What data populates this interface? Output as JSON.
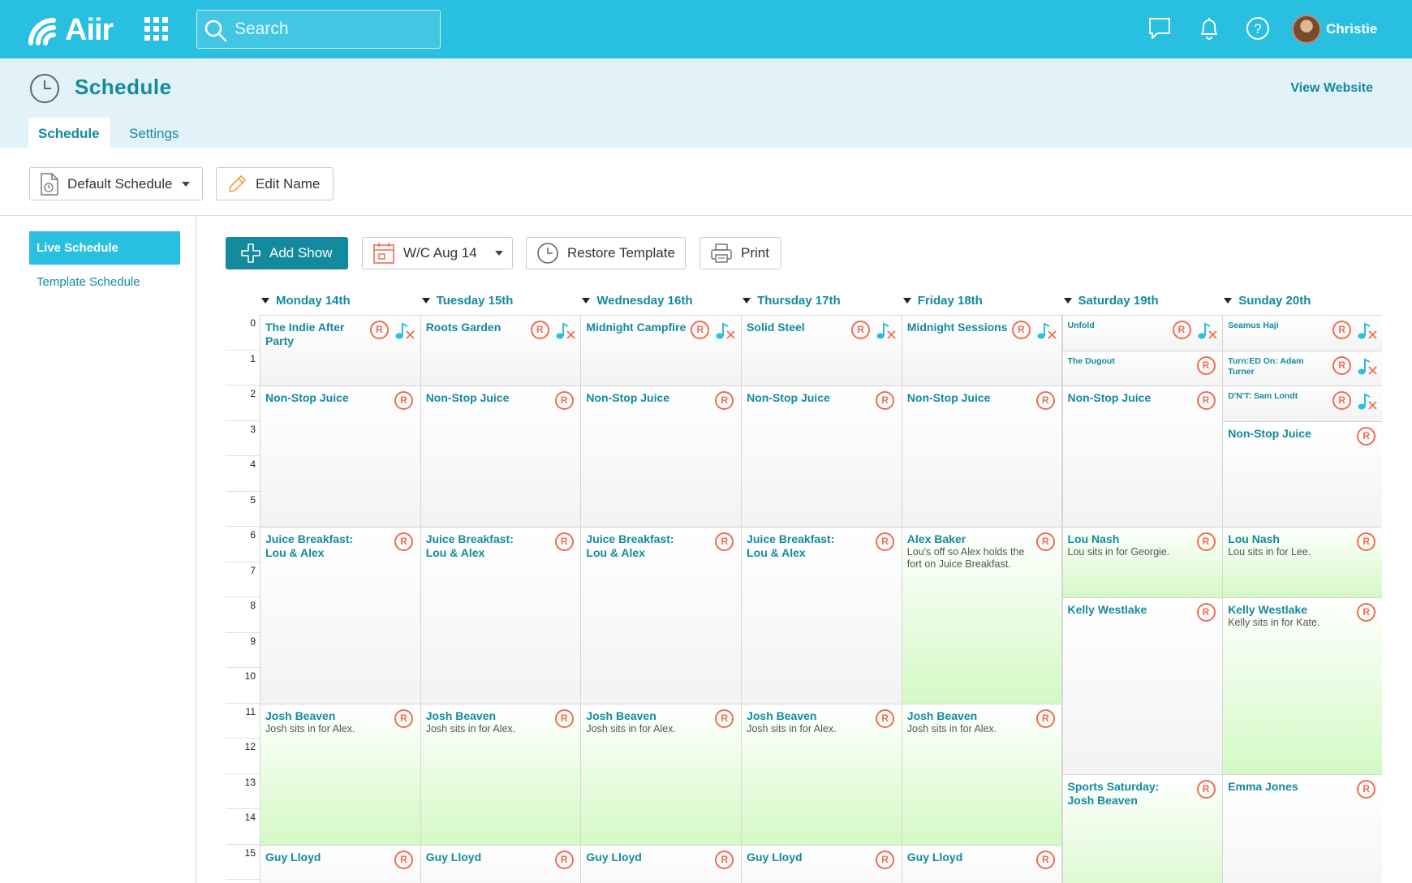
{
  "app": {
    "name": "Aiir",
    "user": "Christie"
  },
  "search": {
    "placeholder": "Search"
  },
  "page": {
    "title": "Schedule",
    "view_website": "View Website"
  },
  "tabs": [
    {
      "label": "Schedule",
      "active": true
    },
    {
      "label": "Settings",
      "active": false
    }
  ],
  "schedule_select": {
    "value": "Default Schedule"
  },
  "edit_name": "Edit Name",
  "sidebar": {
    "items": [
      {
        "label": "Live Schedule",
        "active": true
      },
      {
        "label": "Template Schedule",
        "active": false
      }
    ]
  },
  "toolbar": {
    "add_show": "Add Show",
    "week": "W/C Aug 14",
    "restore": "Restore Template",
    "print": "Print"
  },
  "colors": {
    "brand": "#29bfe1",
    "dark": "#138a9e",
    "subheader": "#e1f2f9",
    "remove_icon": "#ef6d52"
  },
  "hours": [
    "0",
    "1",
    "2",
    "3",
    "4",
    "5",
    "6",
    "7",
    "8",
    "9",
    "10",
    "11",
    "12",
    "13",
    "14",
    "15"
  ],
  "days": [
    "Monday 14th",
    "Tuesday 15th",
    "Wednesday 16th",
    "Thursday 17th",
    "Friday 18th",
    "Saturday 19th",
    "Sunday 20th"
  ],
  "shows": [
    {
      "day": 0,
      "start": 0,
      "end": 2,
      "title": "The Indie After Party",
      "note": "",
      "green": false,
      "music": true
    },
    {
      "day": 0,
      "start": 2,
      "end": 6,
      "title": "Non-Stop Juice",
      "note": "",
      "green": false,
      "music": false
    },
    {
      "day": 0,
      "start": 6,
      "end": 11,
      "title": "Juice Breakfast: Lou & Alex",
      "note": "",
      "green": false,
      "music": false,
      "remove": true
    },
    {
      "day": 0,
      "start": 11,
      "end": 15,
      "title": "Josh Beaven",
      "note": "Josh sits in for Alex.",
      "green": true,
      "music": false,
      "remove": true
    },
    {
      "day": 0,
      "start": 15,
      "end": 17,
      "title": "Guy Lloyd",
      "note": "",
      "green": false,
      "music": false,
      "remove": true
    },
    {
      "day": 1,
      "start": 0,
      "end": 2,
      "title": "Roots Garden",
      "note": "",
      "green": false,
      "music": true
    },
    {
      "day": 1,
      "start": 2,
      "end": 6,
      "title": "Non-Stop Juice",
      "note": "",
      "green": false,
      "music": false
    },
    {
      "day": 1,
      "start": 6,
      "end": 11,
      "title": "Juice Breakfast: Lou & Alex",
      "note": "",
      "green": false,
      "music": false,
      "remove": true
    },
    {
      "day": 1,
      "start": 11,
      "end": 15,
      "title": "Josh Beaven",
      "note": "Josh sits in for Alex.",
      "green": true,
      "music": false,
      "remove": true
    },
    {
      "day": 1,
      "start": 15,
      "end": 17,
      "title": "Guy Lloyd",
      "note": "",
      "green": false,
      "music": false,
      "remove": true
    },
    {
      "day": 2,
      "start": 0,
      "end": 2,
      "title": "Midnight Campfire",
      "note": "",
      "green": false,
      "music": true
    },
    {
      "day": 2,
      "start": 2,
      "end": 6,
      "title": "Non-Stop Juice",
      "note": "",
      "green": false,
      "music": false
    },
    {
      "day": 2,
      "start": 6,
      "end": 11,
      "title": "Juice Breakfast: Lou & Alex",
      "note": "",
      "green": false,
      "music": false,
      "remove": true
    },
    {
      "day": 2,
      "start": 11,
      "end": 15,
      "title": "Josh Beaven",
      "note": "Josh sits in for Alex.",
      "green": true,
      "music": false,
      "remove": true
    },
    {
      "day": 2,
      "start": 15,
      "end": 17,
      "title": "Guy Lloyd",
      "note": "",
      "green": false,
      "music": false,
      "remove": true
    },
    {
      "day": 3,
      "start": 0,
      "end": 2,
      "title": "Solid Steel",
      "note": "",
      "green": false,
      "music": true
    },
    {
      "day": 3,
      "start": 2,
      "end": 6,
      "title": "Non-Stop Juice",
      "note": "",
      "green": false,
      "music": false
    },
    {
      "day": 3,
      "start": 6,
      "end": 11,
      "title": "Juice Breakfast: Lou & Alex",
      "note": "",
      "green": false,
      "music": false,
      "remove": true
    },
    {
      "day": 3,
      "start": 11,
      "end": 15,
      "title": "Josh Beaven",
      "note": "Josh sits in for Alex.",
      "green": true,
      "music": false,
      "remove": true
    },
    {
      "day": 3,
      "start": 15,
      "end": 17,
      "title": "Guy Lloyd",
      "note": "",
      "green": false,
      "music": false,
      "remove": true
    },
    {
      "day": 4,
      "start": 0,
      "end": 2,
      "title": "Midnight Sessions",
      "note": "",
      "green": false,
      "music": true
    },
    {
      "day": 4,
      "start": 2,
      "end": 6,
      "title": "Non-Stop Juice",
      "note": "",
      "green": false,
      "music": false
    },
    {
      "day": 4,
      "start": 6,
      "end": 11,
      "title": "Alex Baker",
      "note": "Lou's off so Alex holds the fort on Juice Breakfast.",
      "green": true,
      "music": false,
      "remove": true
    },
    {
      "day": 4,
      "start": 11,
      "end": 15,
      "title": "Josh Beaven",
      "note": "Josh sits in for Alex.",
      "green": true,
      "music": false,
      "remove": true
    },
    {
      "day": 4,
      "start": 15,
      "end": 17,
      "title": "Guy Lloyd",
      "note": "",
      "green": false,
      "music": false,
      "remove": true
    },
    {
      "day": 5,
      "start": 0,
      "end": 1,
      "title": "Unfold",
      "note": "",
      "green": false,
      "music": true,
      "small": true
    },
    {
      "day": 5,
      "start": 1,
      "end": 2,
      "title": "The Dugout",
      "note": "",
      "green": false,
      "music": false,
      "small": true
    },
    {
      "day": 5,
      "start": 2,
      "end": 6,
      "title": "Non-Stop Juice",
      "note": "",
      "green": false,
      "music": false
    },
    {
      "day": 5,
      "start": 6,
      "end": 8,
      "title": "Lou Nash",
      "note": "Lou sits in for Georgie.",
      "green": true,
      "music": false,
      "remove": true
    },
    {
      "day": 5,
      "start": 8,
      "end": 13,
      "title": "Kelly Westlake",
      "note": "",
      "green": false,
      "music": false,
      "remove": true
    },
    {
      "day": 5,
      "start": 13,
      "end": 17,
      "title": "Sports Saturday: Josh Beaven",
      "note": "",
      "green": true,
      "music": false,
      "remove": true
    },
    {
      "day": 6,
      "start": 0,
      "end": 1,
      "title": "Seamus Haji",
      "note": "",
      "green": false,
      "music": true,
      "small": true
    },
    {
      "day": 6,
      "start": 1,
      "end": 2,
      "title": "Turn:ED On: Adam Turner",
      "note": "",
      "green": false,
      "music": true,
      "small": true
    },
    {
      "day": 6,
      "start": 2,
      "end": 3,
      "title": "D'N'T: Sam Londt",
      "note": "",
      "green": false,
      "music": true,
      "small": true
    },
    {
      "day": 6,
      "start": 3,
      "end": 6,
      "title": "Non-Stop Juice",
      "note": "",
      "green": false,
      "music": false
    },
    {
      "day": 6,
      "start": 6,
      "end": 8,
      "title": "Lou Nash",
      "note": "Lou sits in for Lee.",
      "green": true,
      "music": false,
      "remove": true
    },
    {
      "day": 6,
      "start": 8,
      "end": 13,
      "title": "Kelly Westlake",
      "note": "Kelly sits in for Kate.",
      "green": true,
      "music": false,
      "remove": true
    },
    {
      "day": 6,
      "start": 13,
      "end": 17,
      "title": "Emma Jones",
      "note": "",
      "green": false,
      "music": false,
      "remove": true
    }
  ]
}
